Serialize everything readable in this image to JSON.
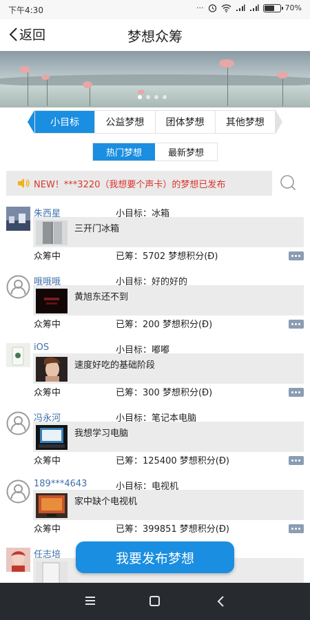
{
  "status_bar": {
    "time": "下午4:30",
    "icons": [
      "alarm-icon",
      "wifi-icon",
      "signal-icon",
      "signal-icon",
      "battery-icon"
    ],
    "battery_percent": 70,
    "battery_text": "70%",
    "dots": "···"
  },
  "header": {
    "back_label": "返回",
    "title": "梦想众筹"
  },
  "category_tabs": [
    {
      "label": "小目标",
      "active": true
    },
    {
      "label": "公益梦想",
      "active": false
    },
    {
      "label": "团体梦想",
      "active": false
    },
    {
      "label": "其他梦想",
      "active": false
    }
  ],
  "sort_tabs": [
    {
      "label": "热门梦想",
      "active": true
    },
    {
      "label": "最新梦想",
      "active": false
    }
  ],
  "notice": {
    "text": "NEW！***3220（我想要个声卡）的梦想已发布"
  },
  "items": [
    {
      "name": "朱西星",
      "goal": "小目标：冰箱",
      "title": "三开门冰箱",
      "state": "众筹中",
      "raised": "已筹：5702 梦想积分(Đ)"
    },
    {
      "name": "哦哦哦",
      "goal": "小目标：好的好的",
      "title": "黄旭东还不到",
      "state": "众筹中",
      "raised": "已筹：200 梦想积分(Đ)"
    },
    {
      "name": "iOS",
      "goal": "小目标：嘟嘟",
      "title": "速度好吃的基础阶段",
      "state": "众筹中",
      "raised": "已筹：300 梦想积分(Đ)"
    },
    {
      "name": "冯永河",
      "goal": "小目标：笔记本电脑",
      "title": "我想学习电脑",
      "state": "众筹中",
      "raised": "已筹：125400 梦想积分(Đ)"
    },
    {
      "name": "189***4643",
      "goal": "小目标：电视机",
      "title": "家中缺个电视机",
      "state": "众筹中",
      "raised": "已筹：399851 梦想积分(Đ)"
    },
    {
      "name": "任志培",
      "goal": "",
      "title": "",
      "state": "",
      "raised": ""
    }
  ],
  "publish_button": "我要发布梦想",
  "colors": {
    "accent": "#1a8ee0",
    "notice_text": "#d9352e",
    "name_text": "#3d6fa8",
    "nav_bar": "#272b30"
  }
}
